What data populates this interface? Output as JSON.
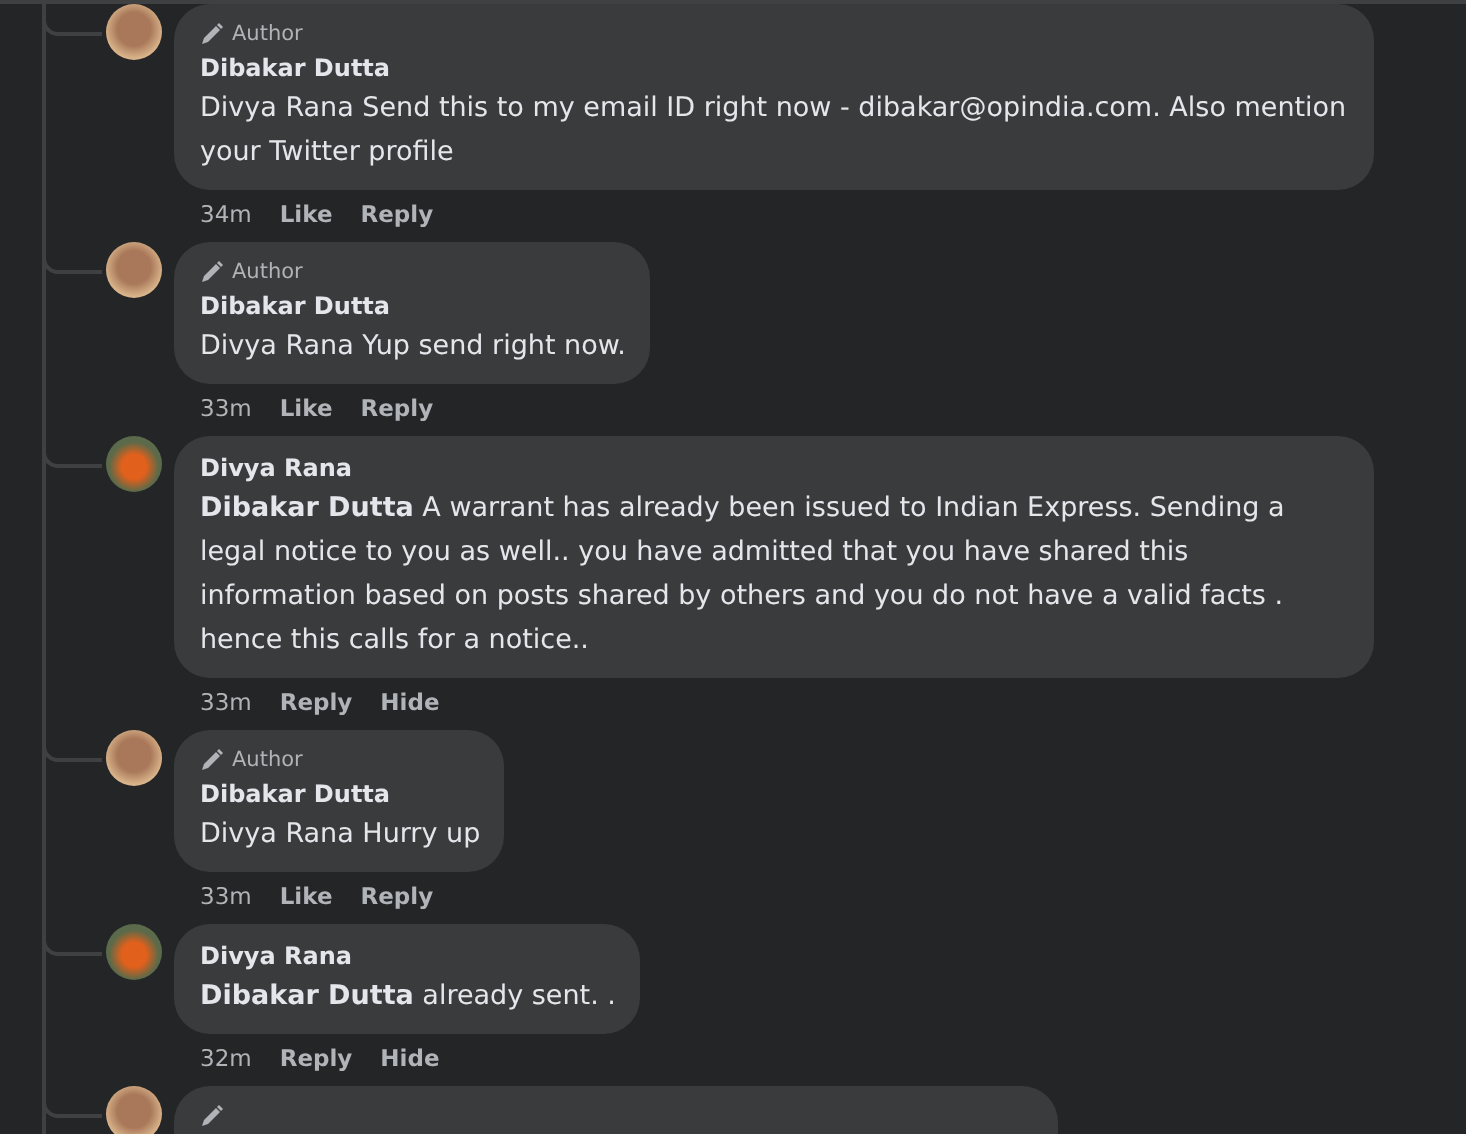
{
  "comments": [
    {
      "kind": "author",
      "badge": "Author",
      "name": "Dibakar Dutta",
      "text": "Divya Rana Send this to my email ID right now - dibakar@opindia.com. Also mention your Twitter profile",
      "time": "34m",
      "actions": [
        "Like",
        "Reply"
      ]
    },
    {
      "kind": "author",
      "badge": "Author",
      "name": "Dibakar Dutta",
      "text": "Divya Rana Yup send right now.",
      "time": "33m",
      "actions": [
        "Like",
        "Reply"
      ]
    },
    {
      "kind": "other",
      "name": "Divya Rana",
      "text": "**Dibakar Dutta** A warrant has already been issued to Indian Express. Sending a legal notice to you as well.. you have admitted that you have shared this information based on posts shared by others and you do not have a valid facts . hence this calls for a notice..",
      "time": "33m",
      "actions": [
        "Reply",
        "Hide"
      ]
    },
    {
      "kind": "author",
      "badge": "Author",
      "name": "Dibakar Dutta",
      "text": "Divya Rana Hurry up",
      "time": "33m",
      "actions": [
        "Like",
        "Reply"
      ]
    },
    {
      "kind": "other",
      "name": "Divya Rana",
      "text": "**Dibakar Dutta** already sent. .",
      "time": "32m",
      "actions": [
        "Reply",
        "Hide"
      ]
    },
    {
      "kind": "author"
    }
  ]
}
